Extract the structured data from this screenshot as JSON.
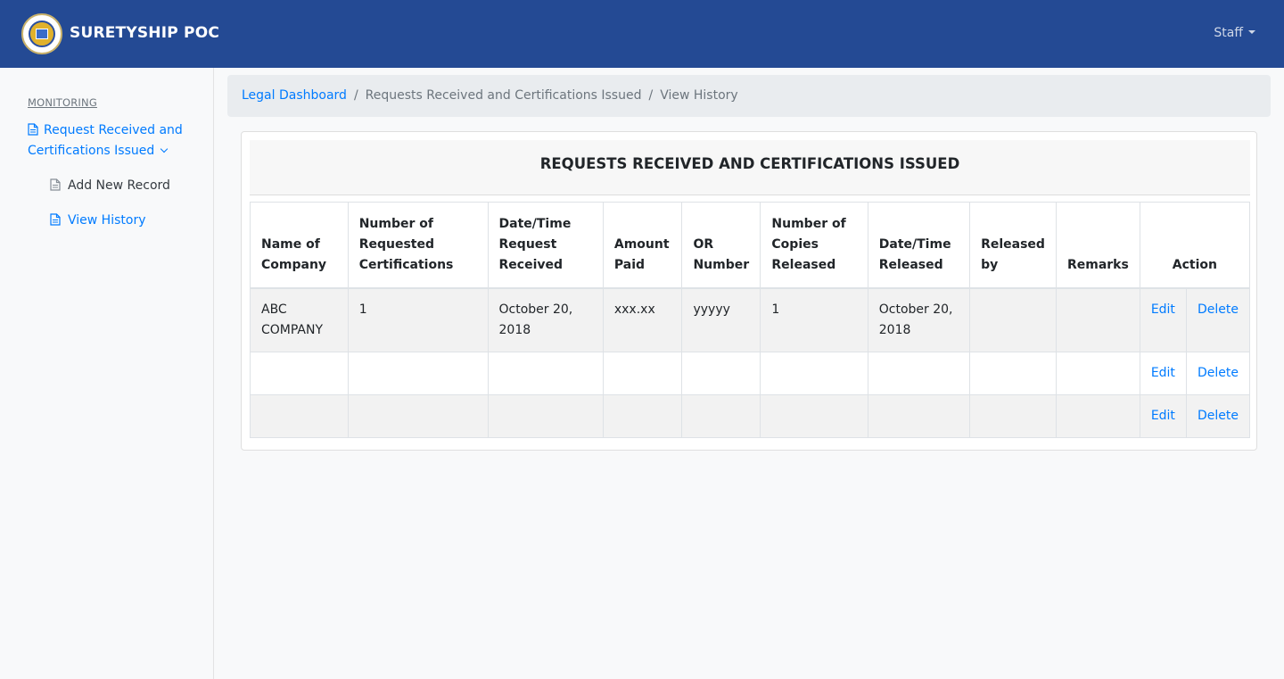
{
  "navbar": {
    "brand": "SURETYSHIP POC",
    "user_menu": "Staff"
  },
  "sidebar": {
    "heading": "MONITORING",
    "main_item": "Request Received and Certifications Issued",
    "sub_items": [
      {
        "label": "Add New Record"
      },
      {
        "label": "View History"
      }
    ]
  },
  "breadcrumb": [
    "Legal Dashboard",
    "Requests Received and Certifications Issued",
    "View History"
  ],
  "card": {
    "title": "REQUESTS RECEIVED AND CERTIFICATIONS ISSUED"
  },
  "table": {
    "columns": [
      "Name of Company",
      "Number of Requested Certifications",
      "Date/Time Request Received",
      "Amount Paid",
      "OR Number",
      "Number of Copies Released",
      "Date/Time Released",
      "Released by",
      "Remarks",
      "Action"
    ],
    "rows": [
      {
        "cells": [
          "ABC COMPANY",
          "1",
          "October 20, 2018",
          "xxx.xx",
          "yyyyy",
          "1",
          "October 20, 2018",
          "",
          ""
        ],
        "edit": "Edit",
        "delete": "Delete"
      },
      {
        "cells": [
          "",
          "",
          "",
          "",
          "",
          "",
          "",
          "",
          ""
        ],
        "edit": "Edit",
        "delete": "Delete"
      },
      {
        "cells": [
          "",
          "",
          "",
          "",
          "",
          "",
          "",
          "",
          ""
        ],
        "edit": "Edit",
        "delete": "Delete"
      }
    ]
  },
  "colors": {
    "navbar_bg": "#244a94",
    "link": "#007bff",
    "breadcrumb_bg": "#e9ecef"
  },
  "icons": {
    "logo": "seal-logo",
    "document": "file-text-icon",
    "user_caret": "caret-down-icon",
    "menu_chevron": "chevron-down-icon"
  }
}
